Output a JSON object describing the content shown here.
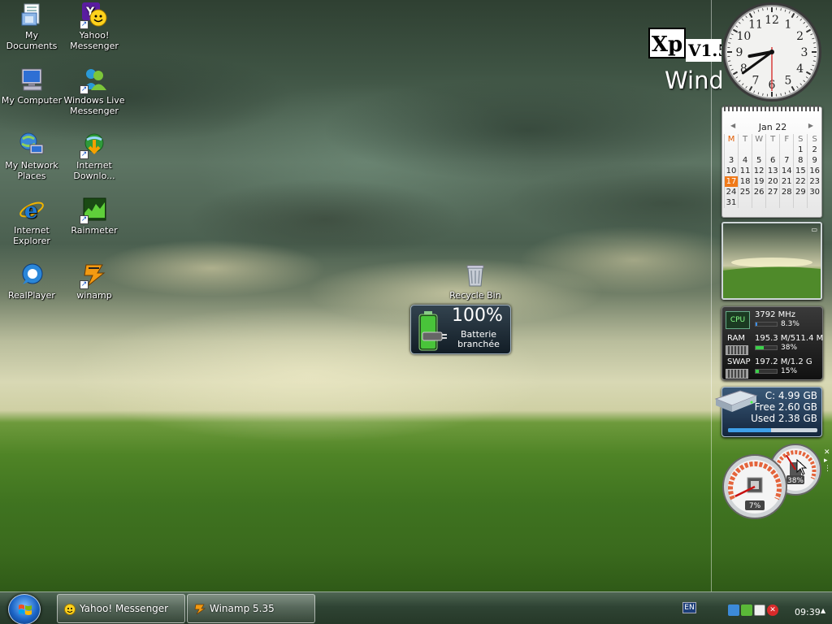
{
  "desktop": {
    "icons": [
      {
        "label": "My Documents",
        "icon": "my-documents-icon"
      },
      {
        "label": "Yahoo!\nMessenger",
        "icon": "yahoo-messenger-icon"
      },
      {
        "label": "My Computer",
        "icon": "my-computer-icon"
      },
      {
        "label": "Windows Live\nMessenger",
        "icon": "windows-live-messenger-icon"
      },
      {
        "label": "My Network\nPlaces",
        "icon": "network-places-icon"
      },
      {
        "label": "Internet\nDownlo...",
        "icon": "internet-download-manager-icon"
      },
      {
        "label": "Internet\nExplorer",
        "icon": "internet-explorer-icon"
      },
      {
        "label": "Rainmeter",
        "icon": "rainmeter-icon"
      },
      {
        "label": "RealPlayer",
        "icon": "realplayer-icon"
      },
      {
        "label": "winamp",
        "icon": "winamp-icon"
      },
      {
        "label": "Recycle Bin",
        "icon": "recycle-bin-icon"
      }
    ]
  },
  "battery_widget": {
    "percent_text": "100%",
    "status_line1": "Batterie",
    "status_line2": "branchée",
    "level": 1.0
  },
  "branding": {
    "xp": "Xp",
    "version": "V1.5",
    "windows_text": "Windows"
  },
  "clock": {
    "hour": 8,
    "minute": 39,
    "second": 30,
    "numerals": [
      "12",
      "1",
      "2",
      "3",
      "4",
      "5",
      "6",
      "7",
      "8",
      "9",
      "10",
      "11"
    ]
  },
  "calendar": {
    "month_label": "Jan 22",
    "day_headers": [
      "M",
      "T",
      "W",
      "T",
      "F",
      "S",
      "S"
    ],
    "weeks": [
      [
        "",
        "",
        "",
        "",
        "",
        "1",
        "2"
      ],
      [
        "3",
        "4",
        "5",
        "6",
        "7",
        "8",
        "9"
      ],
      [
        "10",
        "11",
        "12",
        "13",
        "14",
        "15",
        "16"
      ],
      [
        "17",
        "18",
        "19",
        "20",
        "21",
        "22",
        "23"
      ],
      [
        "24",
        "25",
        "26",
        "27",
        "28",
        "29",
        "30"
      ],
      [
        "31",
        "",
        "",
        "",
        "",
        "",
        ""
      ]
    ],
    "today": "17"
  },
  "system_meter": {
    "cpu_label": "CPU",
    "cpu_freq": "3792 MHz",
    "cpu_pct": "8.3%",
    "cpu_level": 0.083,
    "ram_label": "RAM",
    "ram_value": "195.3 M/511.4 M",
    "ram_pct": "38%",
    "ram_level": 0.38,
    "swap_label": "SWAP",
    "swap_value": "197.2 M/1.2 G",
    "swap_pct": "15%",
    "swap_level": 0.15
  },
  "drive_meter": {
    "drive_line": "C:  4.99 GB",
    "free_line": "Free 2.60 GB",
    "used_line": "Used 2.38 GB",
    "used_level": 0.48
  },
  "gauges": {
    "cpu_gauge_pct": "7%",
    "cpu_gauge_level": 0.07,
    "mem_gauge_pct": "38%",
    "mem_gauge_level": 0.38
  },
  "taskbar": {
    "buttons": [
      {
        "label": "Yahoo! Messenger",
        "icon": "yahoo-messenger-icon"
      },
      {
        "label": "Winamp 5.35",
        "icon": "winamp-icon"
      }
    ],
    "language": "EN",
    "time": "09:39"
  }
}
